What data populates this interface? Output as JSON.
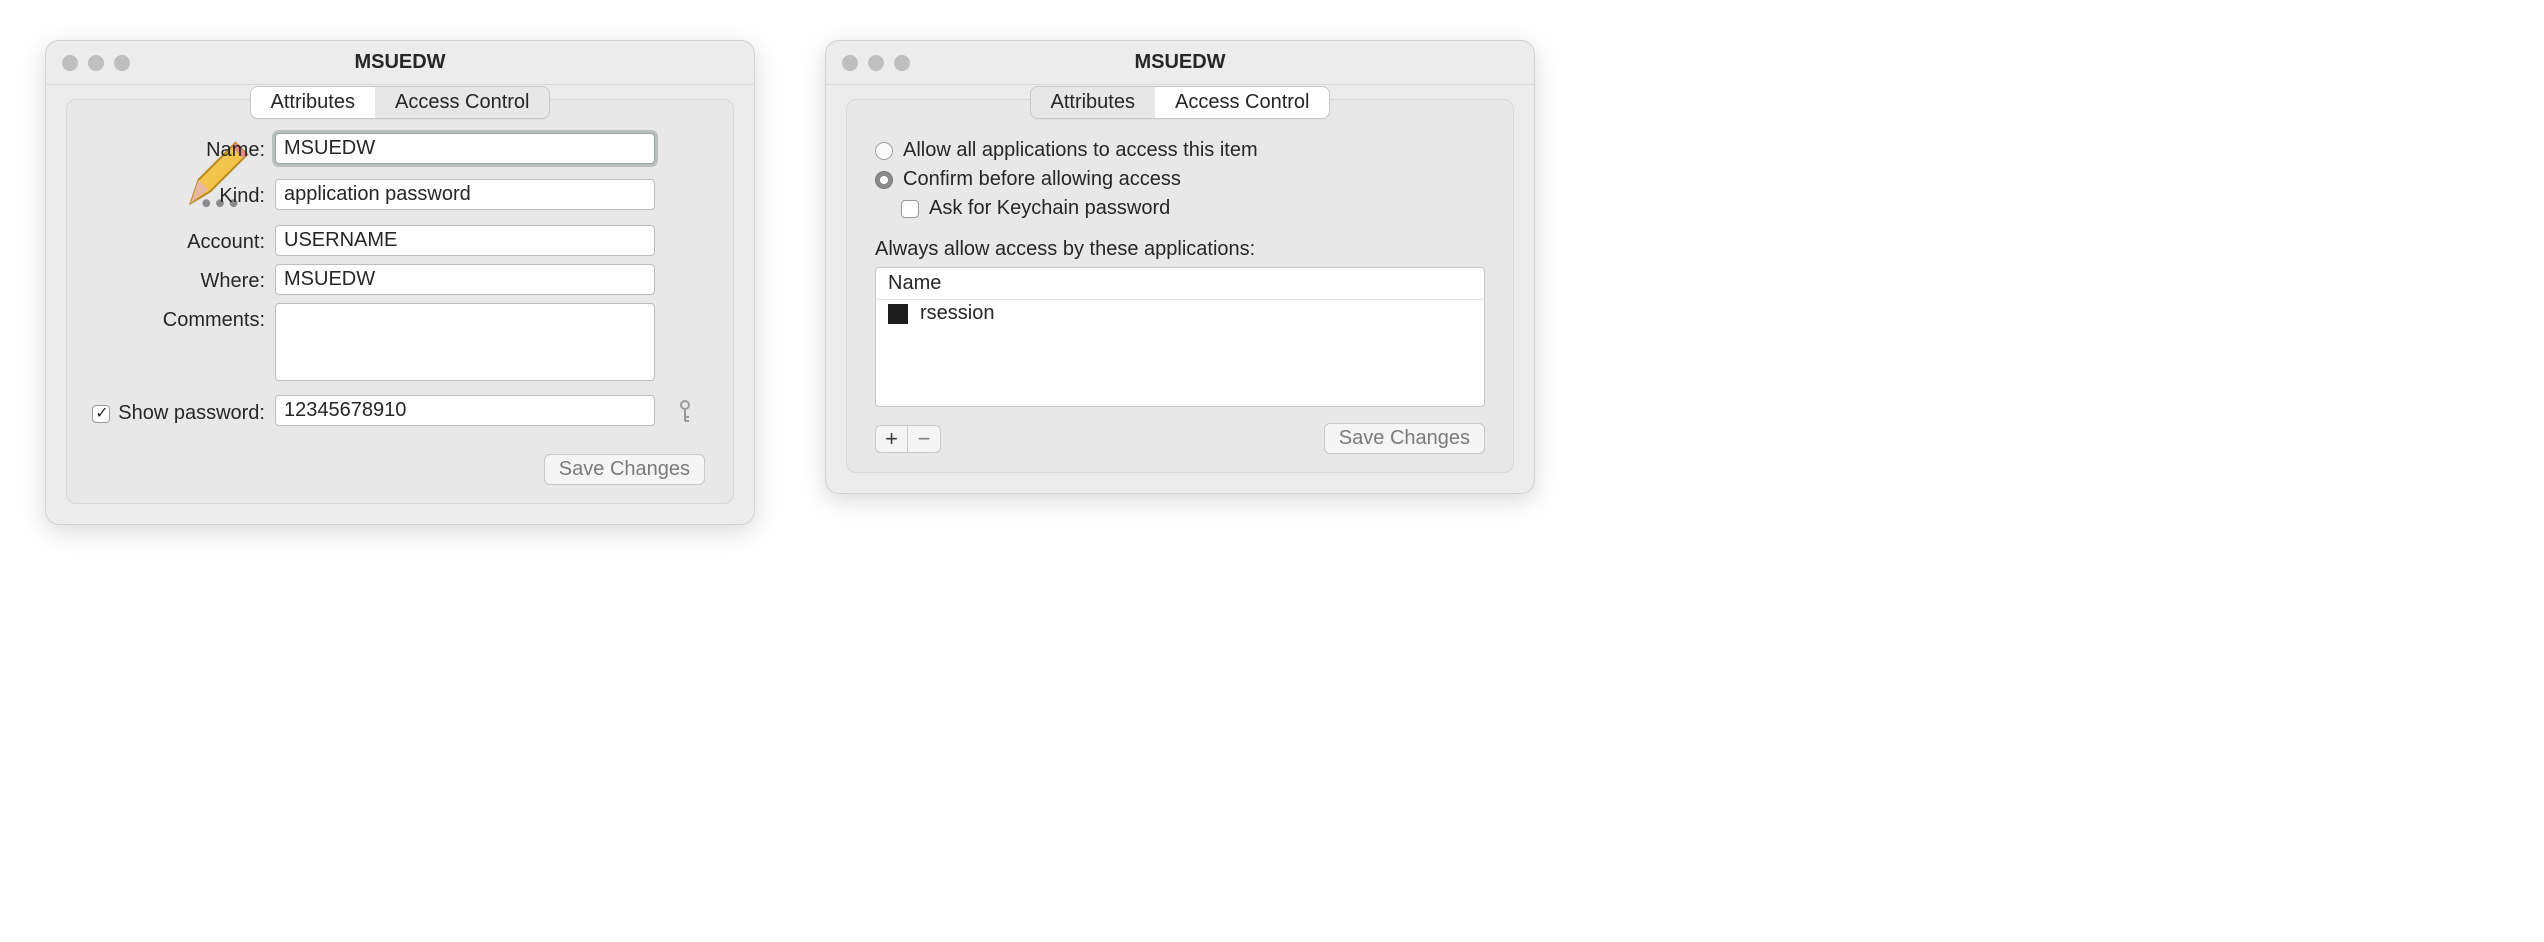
{
  "left": {
    "title": "MSUEDW",
    "tabs": {
      "attributes": "Attributes",
      "access_control": "Access Control"
    },
    "labels": {
      "name": "Name:",
      "kind": "Kind:",
      "account": "Account:",
      "where": "Where:",
      "comments": "Comments:",
      "show_password": "Show password:"
    },
    "values": {
      "name": "MSUEDW",
      "kind": "application password",
      "account": "USERNAME",
      "where": "MSUEDW",
      "comments": "",
      "password": "12345678910"
    },
    "show_password_checked": true,
    "save_button": "Save Changes"
  },
  "right": {
    "title": "MSUEDW",
    "tabs": {
      "attributes": "Attributes",
      "access_control": "Access Control"
    },
    "radios": {
      "allow_all": "Allow all applications to access this item",
      "confirm": "Confirm before allowing access"
    },
    "selected_radio": "confirm",
    "ask_keychain": "Ask for Keychain password",
    "ask_keychain_checked": false,
    "list_label": "Always allow access by these applications:",
    "list_header": "Name",
    "apps": [
      {
        "name": "rsession"
      }
    ],
    "plus": "+",
    "minus": "−",
    "save_button": "Save Changes"
  }
}
